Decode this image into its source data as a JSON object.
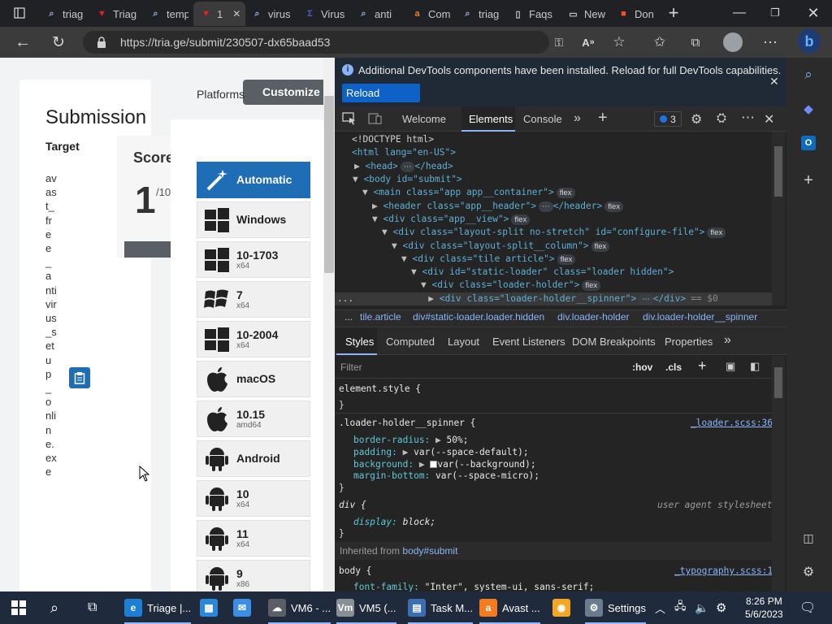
{
  "browser": {
    "tabs": [
      {
        "title": "triag",
        "icon": "search-icon"
      },
      {
        "title": "Triag",
        "icon": "triage-icon"
      },
      {
        "title": "temp",
        "icon": "search-icon"
      },
      {
        "title": "1",
        "icon": "triage-icon"
      },
      {
        "title": "virus",
        "icon": "search-icon"
      },
      {
        "title": "Virus",
        "icon": "virus-total-icon"
      },
      {
        "title": "anti",
        "icon": "search-icon"
      },
      {
        "title": "Com",
        "icon": "avast-icon"
      },
      {
        "title": "triag",
        "icon": "search-icon"
      },
      {
        "title": "Faqs",
        "icon": "page-icon"
      },
      {
        "title": "New",
        "icon": "new-tab-icon"
      },
      {
        "title": "Don",
        "icon": "microsoft-icon"
      }
    ],
    "url": "https://tria.ge/submit/230507-dx65baad53"
  },
  "page": {
    "submission_title": "Submission",
    "target_label": "Target",
    "target_value": "avast_free_antivirus_setup_online.exe",
    "score_label": "Score",
    "score_value": "1",
    "score_max": "/10",
    "customize_label": "Customize",
    "platforms_label": "Platforms",
    "platforms": [
      {
        "name": "Automatic",
        "sub": "",
        "icon": "wand-icon",
        "selected": true
      },
      {
        "name": "Windows",
        "sub": "",
        "icon": "windows-icon"
      },
      {
        "name": "10-1703",
        "sub": "x64",
        "icon": "windows-icon"
      },
      {
        "name": "7",
        "sub": "x64",
        "icon": "windows7-icon"
      },
      {
        "name": "10-2004",
        "sub": "x64",
        "icon": "windows-icon"
      },
      {
        "name": "macOS",
        "sub": "",
        "icon": "apple-icon"
      },
      {
        "name": "10.15",
        "sub": "amd64",
        "icon": "apple-icon"
      },
      {
        "name": "Android",
        "sub": "",
        "icon": "android-icon"
      },
      {
        "name": "10",
        "sub": "x64",
        "icon": "android-icon"
      },
      {
        "name": "11",
        "sub": "x64",
        "icon": "android-icon"
      },
      {
        "name": "9",
        "sub": "x86",
        "icon": "android-icon"
      }
    ]
  },
  "devtools": {
    "info_message": "Additional DevTools components have been installed. Reload for full DevTools capabilities.",
    "reload_label": "Reload DevTools",
    "tabs": [
      "Welcome",
      "Elements",
      "Console"
    ],
    "issues_count": "3",
    "dom": {
      "doctype": "<!DOCTYPE html>",
      "html_open": "<html lang=\"en-US\">",
      "head": "<head>",
      "head_close": "</head>",
      "body": "<body id=\"submit\">",
      "main": "<main class=\"app app__container\">",
      "header": "<header class=\"app__header\">",
      "header_close": "</header>",
      "app_view": "<div class=\"app__view\">",
      "layout_split": "<div class=\"layout-split no-stretch\" id=\"configure-file\">",
      "layout_col": "<div class=\"layout-split__column\">",
      "tile": "<div class=\"tile article\">",
      "loader": "<div id=\"static-loader\" class=\"loader hidden\">",
      "loader_holder": "<div class=\"loader-holder\">",
      "spinner": "<div class=\"loader-holder__spinner\">",
      "spinner_close": "</div>",
      "selected_marker": "== $0",
      "flex_badge": "flex",
      "ellipsis": "⋯",
      "more_dots": "..."
    },
    "breadcrumbs": [
      "...",
      "tile.article",
      "div#static-loader.loader.hidden",
      "div.loader-holder",
      "div.loader-holder__spinner"
    ],
    "style_tabs": [
      "Styles",
      "Computed",
      "Layout",
      "Event Listeners",
      "DOM Breakpoints",
      "Properties"
    ],
    "filter_placeholder": "Filter",
    "hov_label": ":hov",
    "cls_label": ".cls",
    "rules": {
      "element_style": "element.style {",
      "close_brace": "}",
      "spinner_selector": ".loader-holder__spinner {",
      "spinner_source": "_loader.scss:36",
      "p1_name": "border-radius:",
      "p1_value": "50%;",
      "p2_name": "padding:",
      "p2_value": "var(--space-default);",
      "p3_name": "background:",
      "p3_value": "var(--background);",
      "p4_name": "margin-bottom:",
      "p4_value": "var(--space-micro);",
      "div_selector": "div {",
      "div_source": "user agent stylesheet",
      "div_prop": "display:",
      "div_value": "block;",
      "inherited_label": "Inherited from",
      "inherited_from": "body#submit",
      "body_selector": "body {",
      "body_source": "_typography.scss:1",
      "body_prop": "font-family:",
      "body_value": "\"Inter\", system-ui, sans-serif;"
    }
  },
  "taskbar": {
    "items": [
      {
        "label": "Triage |...",
        "icon": "edge-icon"
      },
      {
        "label": "",
        "icon": "store-icon"
      },
      {
        "label": "",
        "icon": "mail-icon"
      },
      {
        "label": "VM6 - ...",
        "icon": "vm-icon"
      },
      {
        "label": "VM5 (...",
        "icon": "vmware-icon"
      },
      {
        "label": "Task M...",
        "icon": "task-manager-icon"
      },
      {
        "label": "Avast ...",
        "icon": "avast-icon"
      },
      {
        "label": "",
        "icon": "shield-icon"
      },
      {
        "label": "Settings",
        "icon": "gear-icon"
      }
    ],
    "time": "8:26 PM",
    "date": "5/6/2023"
  }
}
